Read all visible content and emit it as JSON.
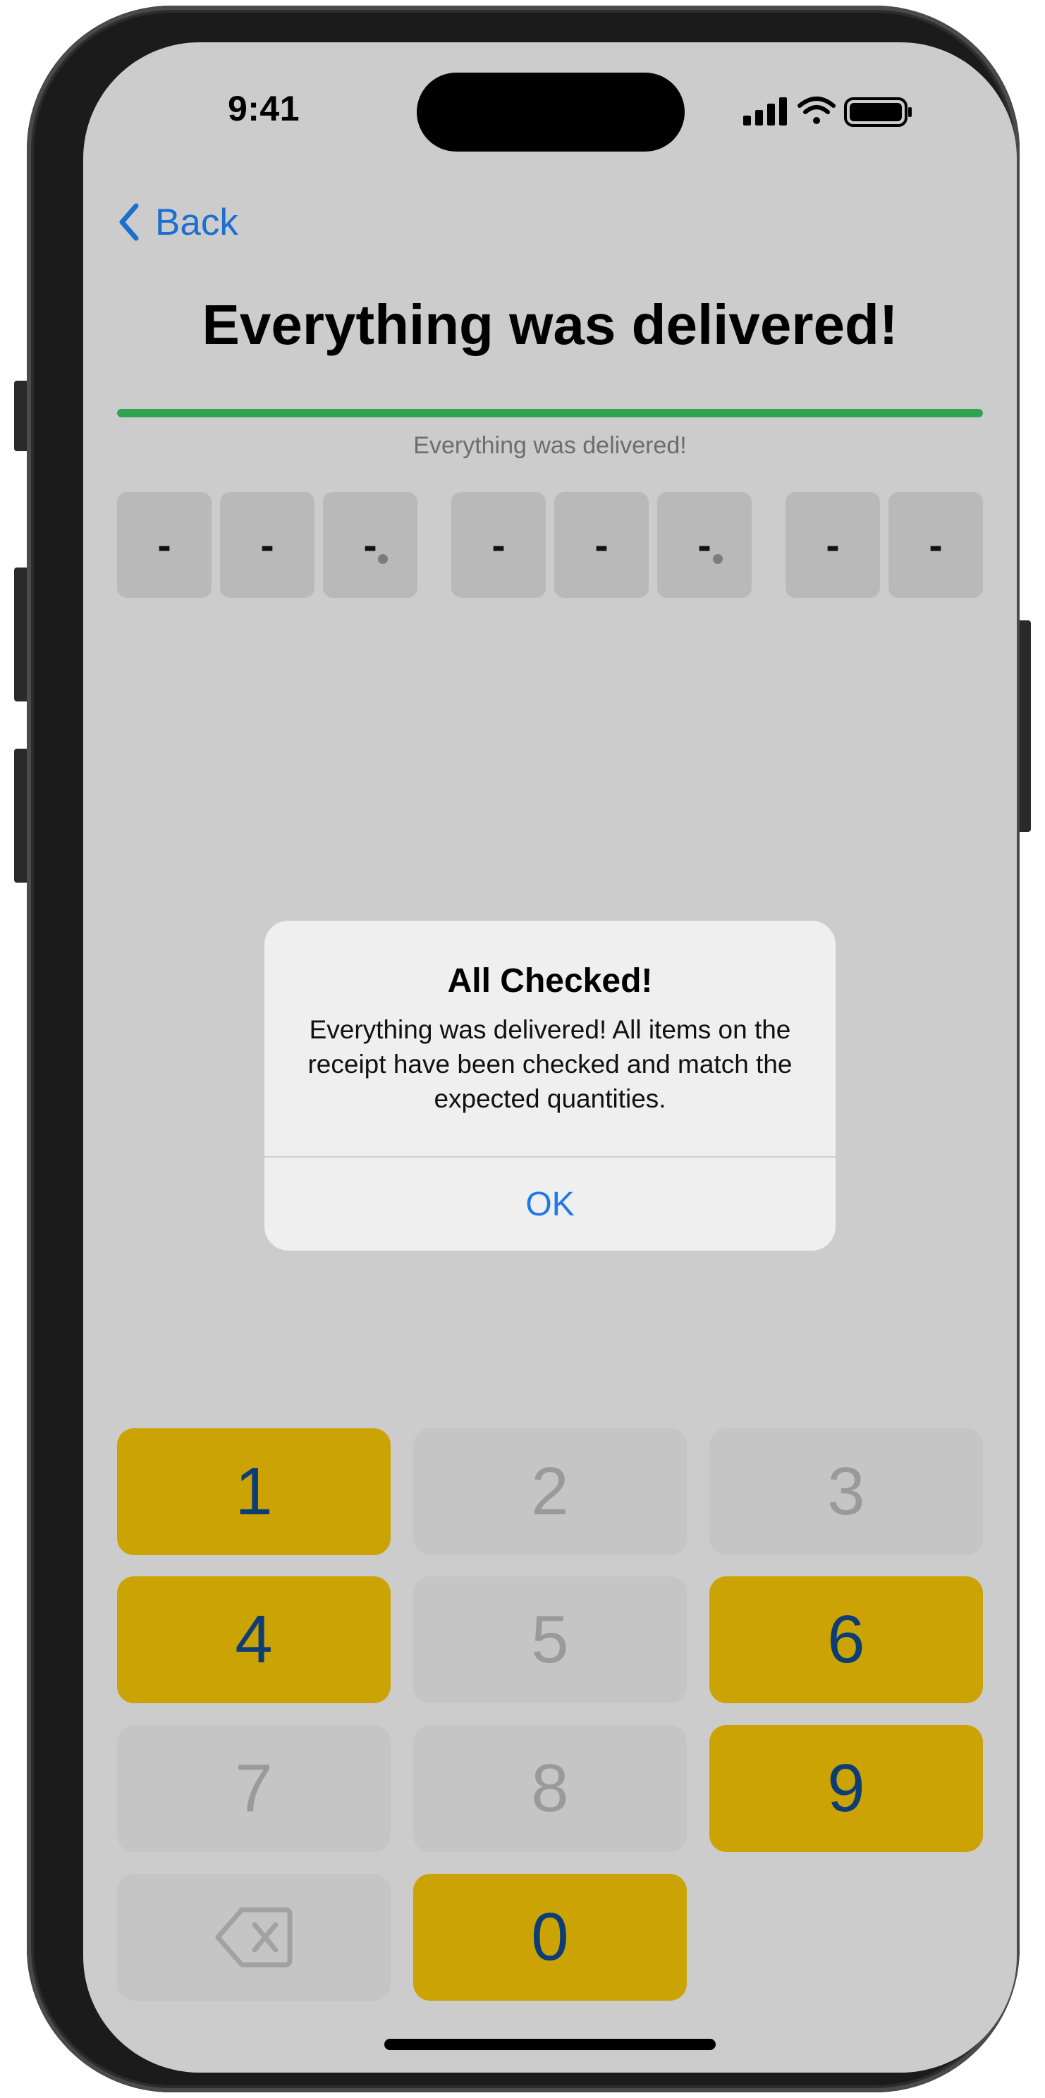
{
  "status_bar": {
    "time": "9:41",
    "icons": [
      "cellular-signal-icon",
      "wifi-icon",
      "battery-icon"
    ]
  },
  "nav": {
    "back_label": "Back",
    "title": "Everything was delivered!"
  },
  "progress": {
    "fraction": 1.0,
    "color": "#2ea44f",
    "label": "Everything was delivered!"
  },
  "code": {
    "groups": [
      [
        "-",
        "-",
        "-"
      ],
      [
        "-",
        "-",
        "-"
      ],
      [
        "-",
        "-"
      ]
    ],
    "separator": "."
  },
  "alert": {
    "title": "All Checked!",
    "message": "Everything was delivered! All items on the receipt have been checked and match the expected quantities.",
    "ok_label": "OK"
  },
  "keypad": {
    "keys": [
      {
        "label": "1",
        "enabled": true
      },
      {
        "label": "2",
        "enabled": false
      },
      {
        "label": "3",
        "enabled": false
      },
      {
        "label": "4",
        "enabled": true
      },
      {
        "label": "5",
        "enabled": false
      },
      {
        "label": "6",
        "enabled": true
      },
      {
        "label": "7",
        "enabled": false
      },
      {
        "label": "8",
        "enabled": false
      },
      {
        "label": "9",
        "enabled": true
      },
      {
        "label": "",
        "icon": "backspace-icon",
        "enabled": false
      },
      {
        "label": "0",
        "enabled": true
      }
    ],
    "accent_color": "#cba304",
    "digit_color": "#0d3d75"
  }
}
